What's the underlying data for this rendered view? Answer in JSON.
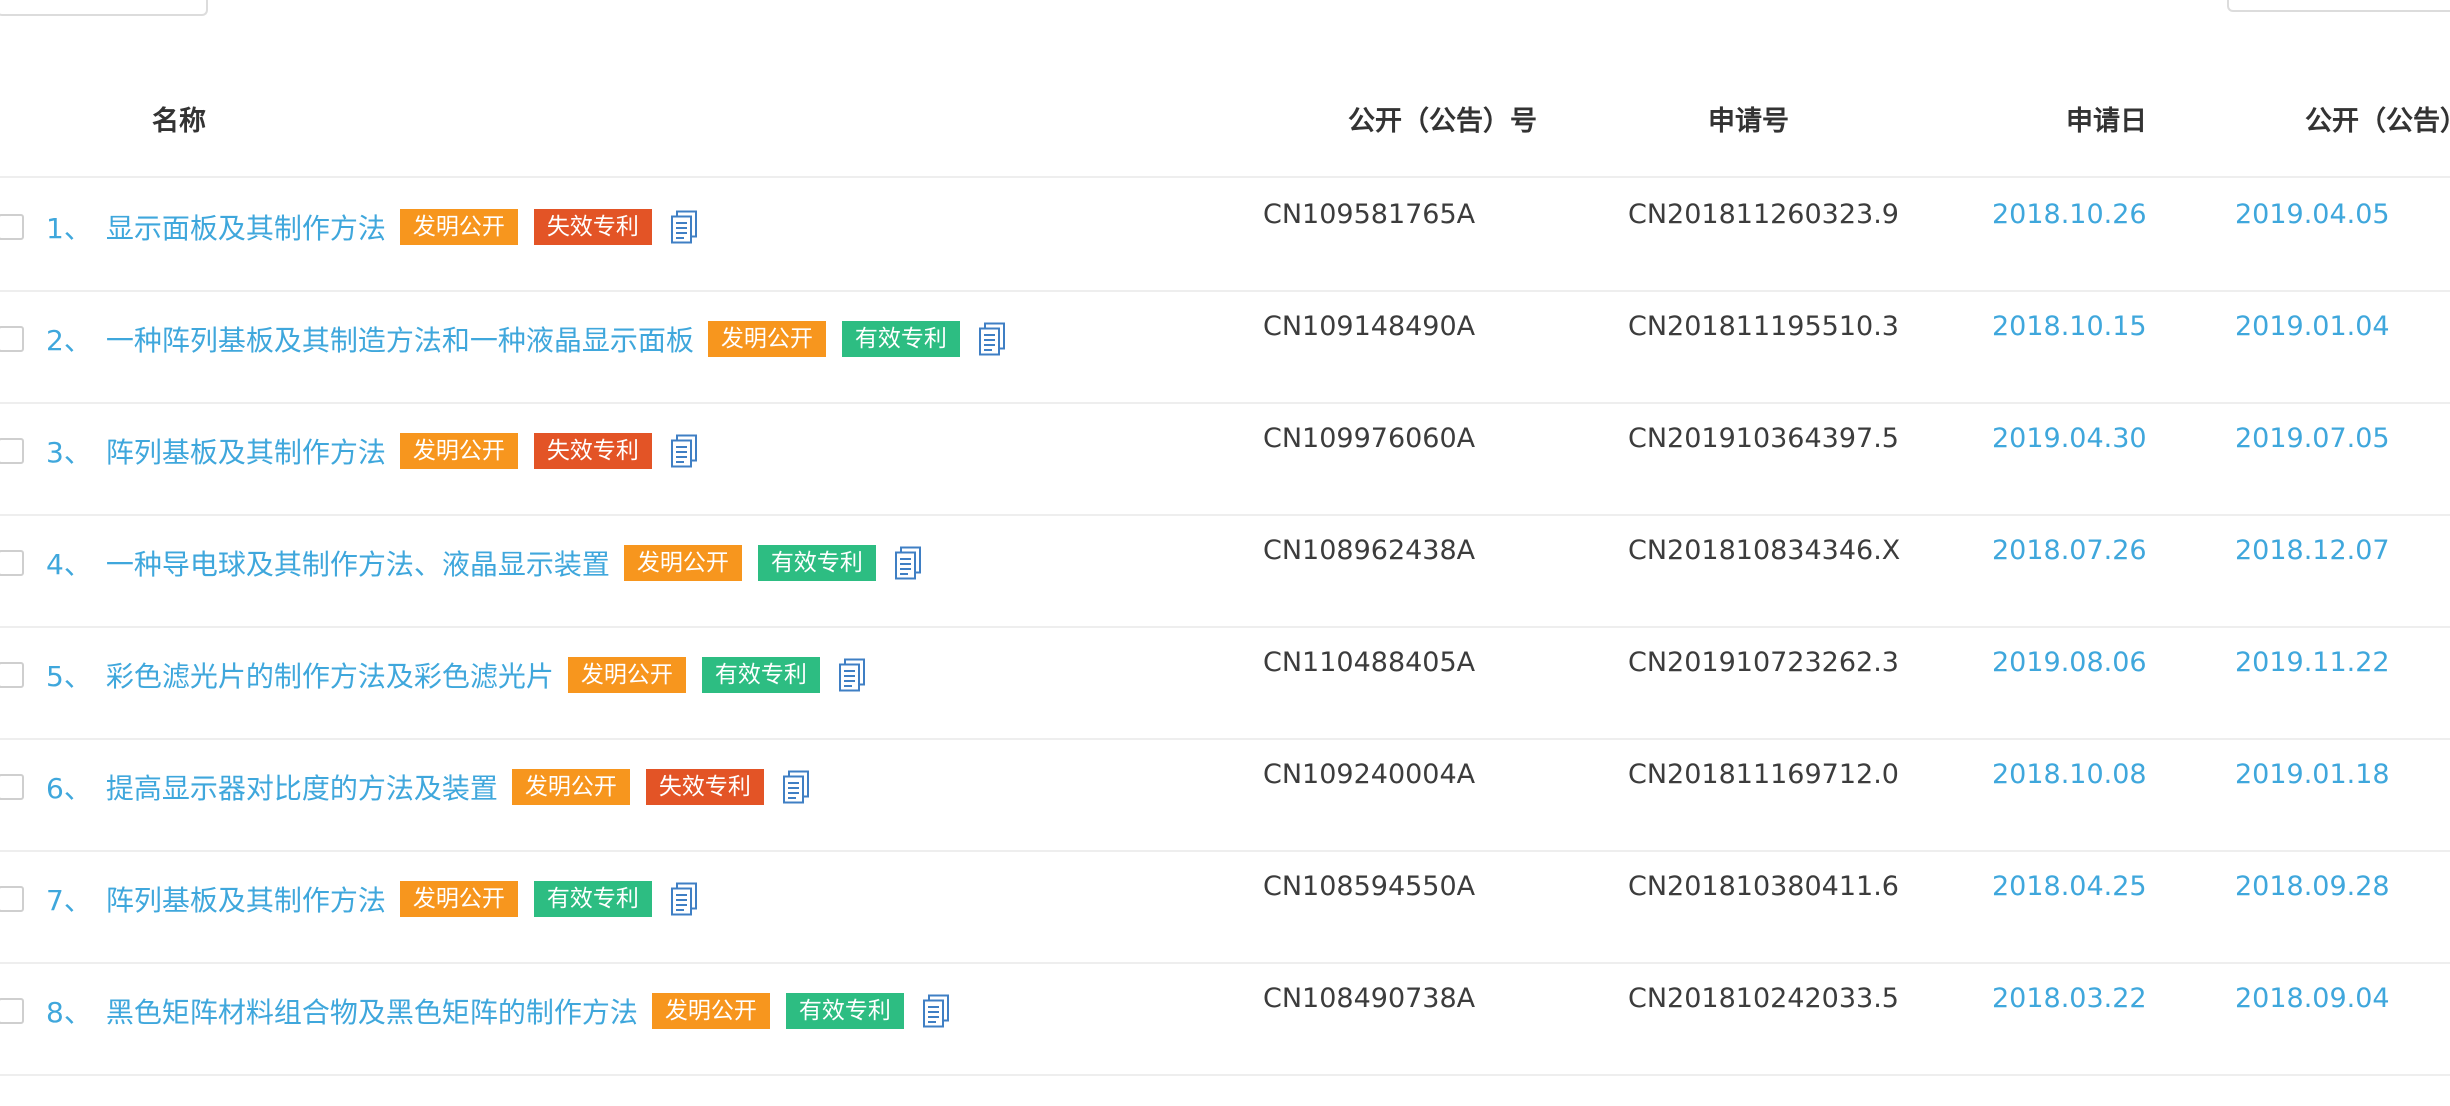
{
  "columns": {
    "name": "名称",
    "pub_no": "公开（公告）号",
    "app_no": "申请号",
    "app_date": "申请日",
    "pub_date": "公开（公告）"
  },
  "tag_colors": {
    "发明公开": "#f7961e",
    "失效专利": "#e35426",
    "有效专利": "#2dbd82"
  },
  "rows": [
    {
      "num": "1、",
      "title": "显示面板及其制作方法",
      "tags": [
        "发明公开",
        "失效专利"
      ],
      "pub_no": "CN109581765A",
      "app_no": "CN201811260323.9",
      "app_date": "2018.10.26",
      "pub_date": "2019.04.05"
    },
    {
      "num": "2、",
      "title": "一种阵列基板及其制造方法和一种液晶显示面板",
      "tags": [
        "发明公开",
        "有效专利"
      ],
      "pub_no": "CN109148490A",
      "app_no": "CN201811195510.3",
      "app_date": "2018.10.15",
      "pub_date": "2019.01.04"
    },
    {
      "num": "3、",
      "title": "阵列基板及其制作方法",
      "tags": [
        "发明公开",
        "失效专利"
      ],
      "pub_no": "CN109976060A",
      "app_no": "CN201910364397.5",
      "app_date": "2019.04.30",
      "pub_date": "2019.07.05"
    },
    {
      "num": "4、",
      "title": "一种导电球及其制作方法、液晶显示装置",
      "tags": [
        "发明公开",
        "有效专利"
      ],
      "pub_no": "CN108962438A",
      "app_no": "CN201810834346.X",
      "app_date": "2018.07.26",
      "pub_date": "2018.12.07"
    },
    {
      "num": "5、",
      "title": "彩色滤光片的制作方法及彩色滤光片",
      "tags": [
        "发明公开",
        "有效专利"
      ],
      "pub_no": "CN110488405A",
      "app_no": "CN201910723262.3",
      "app_date": "2019.08.06",
      "pub_date": "2019.11.22"
    },
    {
      "num": "6、",
      "title": "提高显示器对比度的方法及装置",
      "tags": [
        "发明公开",
        "失效专利"
      ],
      "pub_no": "CN109240004A",
      "app_no": "CN201811169712.0",
      "app_date": "2018.10.08",
      "pub_date": "2019.01.18"
    },
    {
      "num": "7、",
      "title": "阵列基板及其制作方法",
      "tags": [
        "发明公开",
        "有效专利"
      ],
      "pub_no": "CN108594550A",
      "app_no": "CN201810380411.6",
      "app_date": "2018.04.25",
      "pub_date": "2018.09.28"
    },
    {
      "num": "8、",
      "title": "黑色矩阵材料组合物及黑色矩阵的制作方法",
      "tags": [
        "发明公开",
        "有效专利"
      ],
      "pub_no": "CN108490738A",
      "app_no": "CN201810242033.5",
      "app_date": "2018.03.22",
      "pub_date": "2018.09.04"
    }
  ],
  "icons": {
    "row_doc": "document-icon"
  }
}
